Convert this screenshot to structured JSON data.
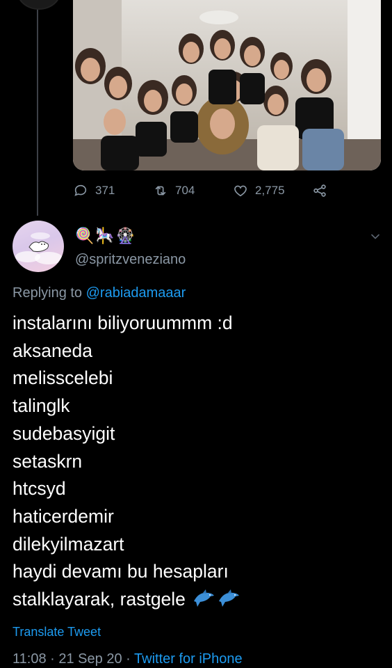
{
  "stats": {
    "replies": "371",
    "retweets": "704",
    "likes": "2,775"
  },
  "author": {
    "display_name_emoji": [
      "🍭",
      "🎠",
      "🎡"
    ],
    "handle": "@spritzveneziano"
  },
  "reply": {
    "prefix": "Replying to",
    "to_handle": "@rabiadamaaar"
  },
  "tweet": {
    "lines": [
      "instalarını biliyoruummm :d",
      "aksaneda",
      "melisscelebi",
      "talinglk",
      "sudebasyigit",
      "setaskrn",
      "htcsyd",
      "haticerdemir",
      "dilekyilmazart",
      "haydi devamı bu hesapları",
      "stalklayarak, rastgele"
    ]
  },
  "translate_label": "Translate Tweet",
  "footer": {
    "time": "11:08",
    "separator": "·",
    "date": "21 Sep 20",
    "source": "Twitter for iPhone"
  },
  "colors": {
    "background": "#000000",
    "muted": "#8b98a5",
    "link": "#1d9bf0",
    "thread_line": "#3d4148"
  },
  "icons": [
    "reply-icon",
    "retweet-icon",
    "like-icon",
    "share-icon",
    "chevron-down-icon",
    "dolphin-icon"
  ]
}
